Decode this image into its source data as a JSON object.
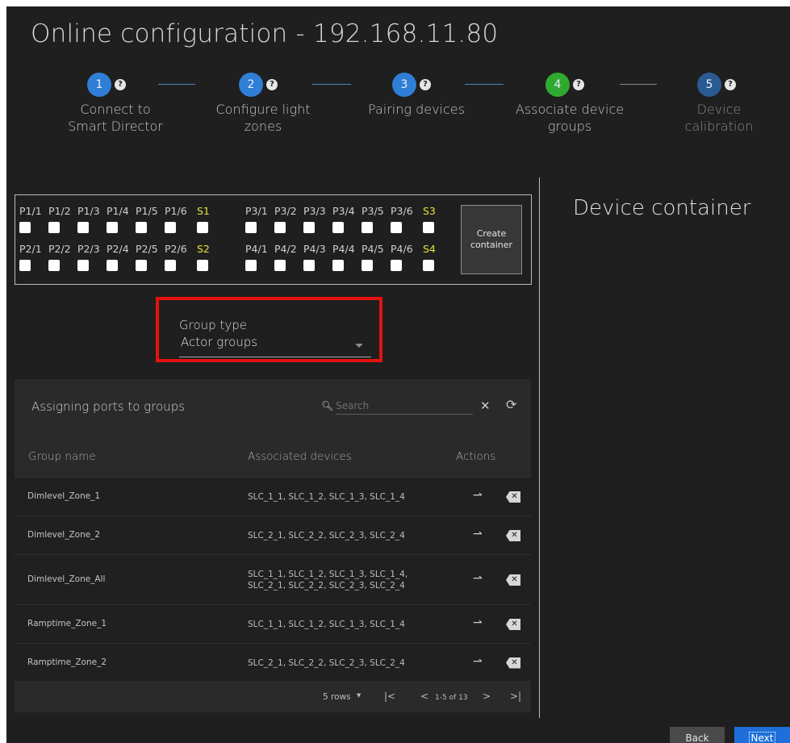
{
  "page_title": "Online configuration - 192.168.11.80",
  "help_glyph": "?",
  "steps": [
    {
      "number": "1",
      "label_line1": "Connect to",
      "label_line2": "Smart Director",
      "state": "done",
      "color": "#2f7fd6"
    },
    {
      "number": "2",
      "label_line1": "Configure light",
      "label_line2": "zones",
      "state": "done",
      "color": "#2f7fd6"
    },
    {
      "number": "3",
      "label_line1": "Pairing devices",
      "label_line2": "",
      "state": "done",
      "color": "#2f7fd6"
    },
    {
      "number": "4",
      "label_line1": "Associate device",
      "label_line2": "groups",
      "state": "active",
      "color": "#2fa92f"
    },
    {
      "number": "5",
      "label_line1": "Device",
      "label_line2": "calibration",
      "state": "pending",
      "color": "#2a5a92"
    }
  ],
  "ports": {
    "row1_left": [
      "P1/1",
      "P1/2",
      "P1/3",
      "P1/4",
      "P1/5",
      "P1/6"
    ],
    "row1_left_s": "S1",
    "row1_right": [
      "P3/1",
      "P3/2",
      "P3/3",
      "P3/4",
      "P3/5",
      "P3/6"
    ],
    "row1_right_s": "S3",
    "row2_left": [
      "P2/1",
      "P2/2",
      "P2/3",
      "P2/4",
      "P2/5",
      "P2/6"
    ],
    "row2_left_s": "S2",
    "row2_right": [
      "P4/1",
      "P4/2",
      "P4/3",
      "P4/4",
      "P4/5",
      "P4/6"
    ],
    "row2_right_s": "S4",
    "create_button_line1": "Create",
    "create_button_line2": "container"
  },
  "group_type": {
    "label": "Group type",
    "value": "Actor groups"
  },
  "table": {
    "title": "Assigning ports to groups",
    "search_placeholder": "Search",
    "columns": {
      "group": "Group name",
      "devices": "Associated devices",
      "actions": "Actions"
    },
    "rows": [
      {
        "name": "Dimlevel_Zone_1",
        "devices": "SLC_1_1, SLC_1_2, SLC_1_3, SLC_1_4"
      },
      {
        "name": "Dimlevel_Zone_2",
        "devices": "SLC_2_1, SLC_2_2, SLC_2_3, SLC_2_4"
      },
      {
        "name": "Dimlevel_Zone_All",
        "devices": "SLC_1_1, SLC_1_2, SLC_1_3, SLC_1_4, SLC_2_1, SLC_2_2, SLC_2_3, SLC_2_4"
      },
      {
        "name": "Ramptime_Zone_1",
        "devices": "SLC_1_1, SLC_1_2, SLC_1_3, SLC_1_4"
      },
      {
        "name": "Ramptime_Zone_2",
        "devices": "SLC_2_1, SLC_2_2, SLC_2_3, SLC_2_4"
      }
    ],
    "pagination": {
      "rows_per_page": "5 rows",
      "range": "1-5 of 13"
    }
  },
  "device_container_title": "Device container",
  "footer": {
    "back": "Back",
    "next": "Next"
  }
}
